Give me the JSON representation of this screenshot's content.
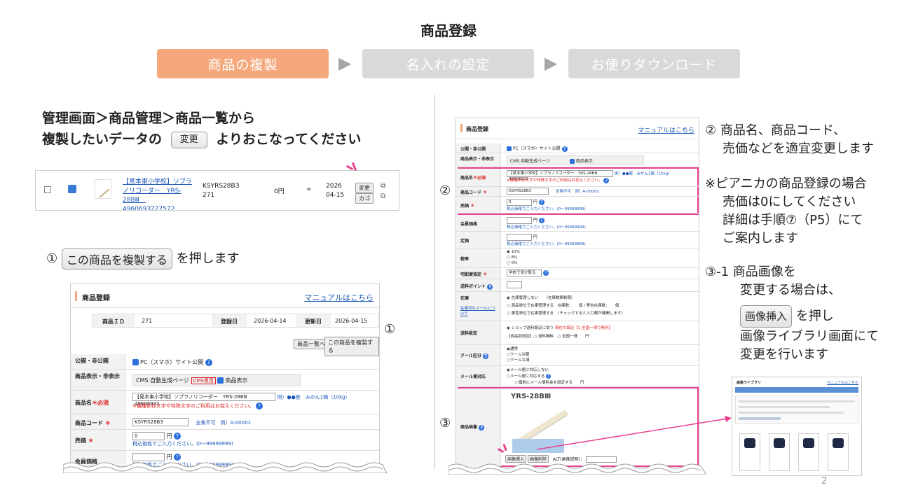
{
  "page_title": "商品登録",
  "steps": [
    "商品の複製",
    "名入れの設定",
    "お便りダウンロード"
  ],
  "instruction": {
    "line1": "管理画面＞商品管理＞商品一覧から",
    "line2a": "複製したいデータの",
    "button": "変更",
    "line2b": "よりおこなってください"
  },
  "list_row": {
    "name": "【見本東小学校】ソプラノリコーダー　YRS-28BⅢ　4960693227572",
    "code": "KSYRS28B3 271",
    "price": "0円",
    "stock": "∞",
    "date": "2026 04-15",
    "btn_edit": "変更",
    "btn_cart": "カゴ"
  },
  "step1": {
    "num": "①",
    "button": "この商品を複製する",
    "text": "を押します"
  },
  "form1": {
    "header": "商品登録",
    "manual": "マニュアルはこちら",
    "id_label": "商品ＩＤ",
    "id_value": "271",
    "reg_label": "登録日",
    "reg_value": "2026-04-14",
    "upd_label": "更新日",
    "upd_value": "2026-04-15",
    "btn_list": "商品一覧へ",
    "btn_copy": "この商品を複製する",
    "callout": "①",
    "rows": {
      "public_label": "公開・非公開",
      "public_value": "PC（スマホ）サイト公開",
      "display_label": "商品表示・非表示",
      "display_value": "CMS 自動生成ページ",
      "cms_tag": "CMS専用",
      "display_check": "商品表示",
      "name_label": "商品名",
      "required": "＊必須",
      "name_value": "【見本東小学校】ソプラノリコーダー　YRS-28BⅢ　49606932",
      "name_example": "例）●●屋　みかん1箱（10kg）",
      "name_warn": "※機種依存文字や特殊文字のご利用はお控えください。",
      "code_label": "商品コード",
      "code_value": "KSYRS28B3",
      "code_hint": "全角不可　例）A-00001",
      "price_label": "売価",
      "price_value": "0",
      "yen": "円",
      "price_hint": "税込価格でご入力ください。(0〜99999999)",
      "member_label": "会員価格"
    }
  },
  "form2": {
    "header": "商品登録",
    "manual": "マニュアルはこちら",
    "public_label": "公開・非公開",
    "public_value": "PC（スマホ）サイト公開",
    "display_label": "商品表示・非表示",
    "display_value": "CMS 自動生成ページ",
    "display_check": "商品表示",
    "name_label": "商品名",
    "required": "＊必須",
    "name_value": "【見本東小学校】ソプラノリコーダー　YRS-28BⅢ　49606932",
    "name_example": "例）●●屋　みかん1箱（10kg）",
    "name_warn": "※機種依存文字や特殊文字のご利用はお控えください。",
    "code_label": "商品コード",
    "code_value": "KSYRS28B3",
    "code_hint": "全角不可　例）A-00001",
    "price_label": "売価",
    "price_value": "0",
    "yen": "円",
    "price_hint": "税込価格でご入力ください。(0〜99999999)",
    "member_label": "会員価格",
    "list_label": "定価",
    "tax_label": "税率",
    "tax_options": [
      "10%",
      "8%",
      "0%"
    ],
    "ship_label": "宅配便指定",
    "ship_value": "学校で受け取る",
    "point_label": "送料ポイント",
    "stock_label": "在庫",
    "stock_link": "在庫切れメールについて",
    "stock_opt1": "在庫管理しない　　（在庫数無制限）",
    "stock_opt2": "商品単位で在庫管理する　在庫数：　　個 / 警告在庫数：　　個",
    "stock_opt3": "属性単位で在庫管理する　（チェックすると入力欄が展開します）",
    "shipping_label": "送料設定",
    "shipping_opt1": "ショップ送料設定に従う",
    "shipping_current": "現在の設定【1.全国一律で無料】",
    "shipping_opt2": "【商品別設定】○ 送料無料　○ 全国一律　　円",
    "cool_label": "クール区分",
    "cool_options": [
      "通常",
      "クール冷蔵",
      "クール冷凍"
    ],
    "mail_label": "メール便対応",
    "mail_opt1": "メール便に対応しない",
    "mail_opt2": "メール便に対応する",
    "mail_opt3": "個別にメール便料金を設定する　　円",
    "image_label": "商品画像",
    "product_model": "YRS-28BⅢ",
    "btn_insert": "画像挿入",
    "btn_delete": "画像削除",
    "alt_label": "ALT(画像説明)：",
    "callout2": "②",
    "callout3": "③"
  },
  "right_notes": {
    "n2_line1": "② 商品名、商品コード、",
    "n2_line2": "売価などを適宜変更します",
    "p_line1": "※ピアニカの商品登録の場合",
    "p_line2": "売価は0にしてください",
    "p_line3": "詳細は手順⑦（P5）にて",
    "p_line4": "ご案内します",
    "n3_line1": "③-1 商品画像を",
    "n3_line2": "変更する場合は、",
    "n3_button": "画像挿入",
    "n3_line3": "を押し",
    "n3_line4": "画像ライブラリ画面にて",
    "n3_line5": "変更を行います"
  },
  "library": {
    "title": "画像ライブラリ",
    "manual": "マニュアルはこちら"
  },
  "page_number": "2",
  "colors": {
    "accent_orange": "#f4a87c",
    "inactive_gray": "#d9d9d9",
    "highlight_pink": "#e9408f",
    "link_blue": "#1a57b8"
  }
}
